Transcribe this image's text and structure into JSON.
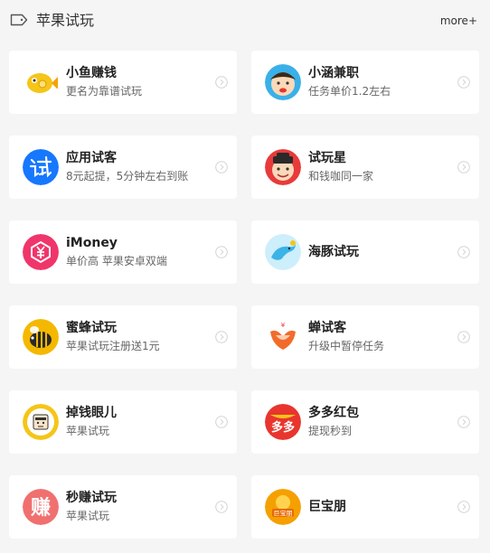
{
  "header": {
    "title": "苹果试玩",
    "more": "more+"
  },
  "apps": [
    {
      "name": "小鱼赚钱",
      "desc": "更名为靠谱试玩",
      "icon": "fish-icon",
      "color": "#f5c518"
    },
    {
      "name": "小涵兼职",
      "desc": "任务单价1.2左右",
      "icon": "boy-face-icon",
      "color": "#3ab0e8"
    },
    {
      "name": "应用试客",
      "desc": "8元起提，5分钟左右到账",
      "icon": "shi-char-icon",
      "color": "#1677ff"
    },
    {
      "name": "试玩星",
      "desc": "和钱咖同一家",
      "icon": "cartoon-face-icon",
      "color": "#e83a3a"
    },
    {
      "name": "iMoney",
      "desc": "单价高 苹果安卓双端",
      "icon": "yuan-coin-icon",
      "color": "#f0356b"
    },
    {
      "name": "海豚试玩",
      "desc": "",
      "icon": "dolphin-icon",
      "color": "#7fd3f2"
    },
    {
      "name": "蜜蜂试玩",
      "desc": "苹果试玩注册送1元",
      "icon": "bee-icon",
      "color": "#f5b800"
    },
    {
      "name": "蝉试客",
      "desc": "升级中暂停任务",
      "icon": "cicada-icon",
      "color": "#f26b2b"
    },
    {
      "name": "掉钱眼儿",
      "desc": "苹果试玩",
      "icon": "coin-face-icon",
      "color": "#f5c518"
    },
    {
      "name": "多多红包",
      "desc": "提现秒到",
      "icon": "red-envelope-icon",
      "color": "#e8352e"
    },
    {
      "name": "秒赚试玩",
      "desc": "苹果试玩",
      "icon": "zhuan-char-icon",
      "color": "#f07070"
    },
    {
      "name": "巨宝朋",
      "desc": "",
      "icon": "treasure-icon",
      "color": "#f5a000"
    }
  ]
}
